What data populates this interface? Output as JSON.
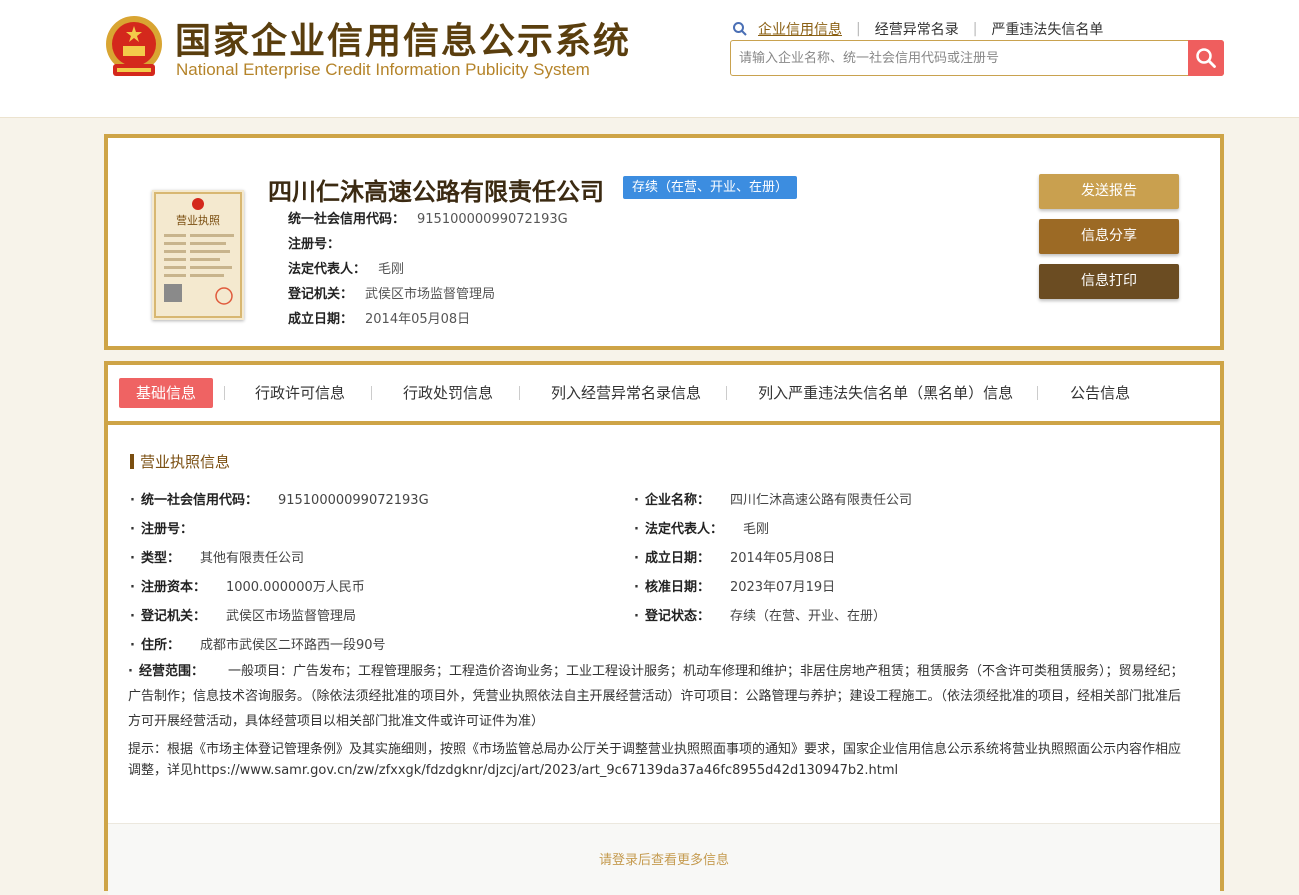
{
  "header": {
    "title_cn": "国家企业信用信息公示系统",
    "title_en": "National Enterprise Credit Information Publicity System",
    "nav": [
      "企业信用信息",
      "经营异常名录",
      "严重违法失信名单"
    ],
    "search_placeholder": "请输入企业名称、统一社会信用代码或注册号",
    "icons": [
      "national-emblem-icon",
      "search-icon"
    ]
  },
  "company": {
    "name": "四川仁沐高速公路有限责任公司",
    "status": "存续（在营、开业、在册）",
    "rows": [
      {
        "label": "统一社会信用代码：",
        "value": "91510000099072193G"
      },
      {
        "label": "注册号：",
        "value": ""
      },
      {
        "label": "法定代表人：",
        "value": "毛刚"
      },
      {
        "label": "登记机关：",
        "value": "武侯区市场监督管理局"
      },
      {
        "label": "成立日期：",
        "value": "2014年05月08日"
      }
    ],
    "license_label": "营业执照",
    "buttons": {
      "send": "发送报告",
      "share": "信息分享",
      "print": "信息打印"
    }
  },
  "tabs": [
    "基础信息",
    "行政许可信息",
    "行政处罚信息",
    "列入经营异常名录信息",
    "列入严重违法失信名单（黑名单）信息",
    "公告信息"
  ],
  "basic_info": {
    "section_title": "营业执照信息",
    "left": [
      {
        "label": "统一社会信用代码：",
        "value": "91510000099072193G"
      },
      {
        "label": "注册号：",
        "value": ""
      },
      {
        "label": "类型：",
        "value": "其他有限责任公司"
      },
      {
        "label": "注册资本：",
        "value": "1000.000000万人民币"
      },
      {
        "label": "登记机关：",
        "value": "武侯区市场监督管理局"
      },
      {
        "label": "住所：",
        "value": "成都市武侯区二环路西一段90号"
      }
    ],
    "right": [
      {
        "label": "企业名称：",
        "value": "四川仁沐高速公路有限责任公司"
      },
      {
        "label": "法定代表人：",
        "value": "毛刚"
      },
      {
        "label": "成立日期：",
        "value": "2014年05月08日"
      },
      {
        "label": "核准日期：",
        "value": "2023年07月19日"
      },
      {
        "label": "登记状态：",
        "value": "存续（在营、开业、在册）"
      }
    ],
    "scope_label": "经营范围：",
    "scope_value": "一般项目：广告发布；工程管理服务；工程造价咨询业务；工业工程设计服务；机动车修理和维护；非居住房地产租赁；租赁服务（不含许可类租赁服务）；贸易经纪；广告制作；信息技术咨询服务。（除依法须经批准的项目外，凭营业执照依法自主开展经营活动）许可项目：公路管理与养护；建设工程施工。（依法须经批准的项目，经相关部门批准后方可开展经营活动，具体经营项目以相关部门批准文件或许可证件为准）",
    "tip": "提示：根据《市场主体登记管理条例》及其实施细则，按照《市场监管总局办公厅关于调整营业执照照面事项的通知》要求，国家企业信用信息公示系统将营业执照照面公示内容作相应调整，详见https://www.samr.gov.cn/zw/zfxxgk/fdzdgknr/djzcj/art/2023/art_9c67139da37a46fc8955d42d130947b2.html",
    "login_hint": "请登录后查看更多信息"
  },
  "colors": {
    "gold": "#cea447",
    "brown": "#5a3e0e",
    "accent_red": "#ef5e5e",
    "status_blue": "#3c8de0"
  }
}
